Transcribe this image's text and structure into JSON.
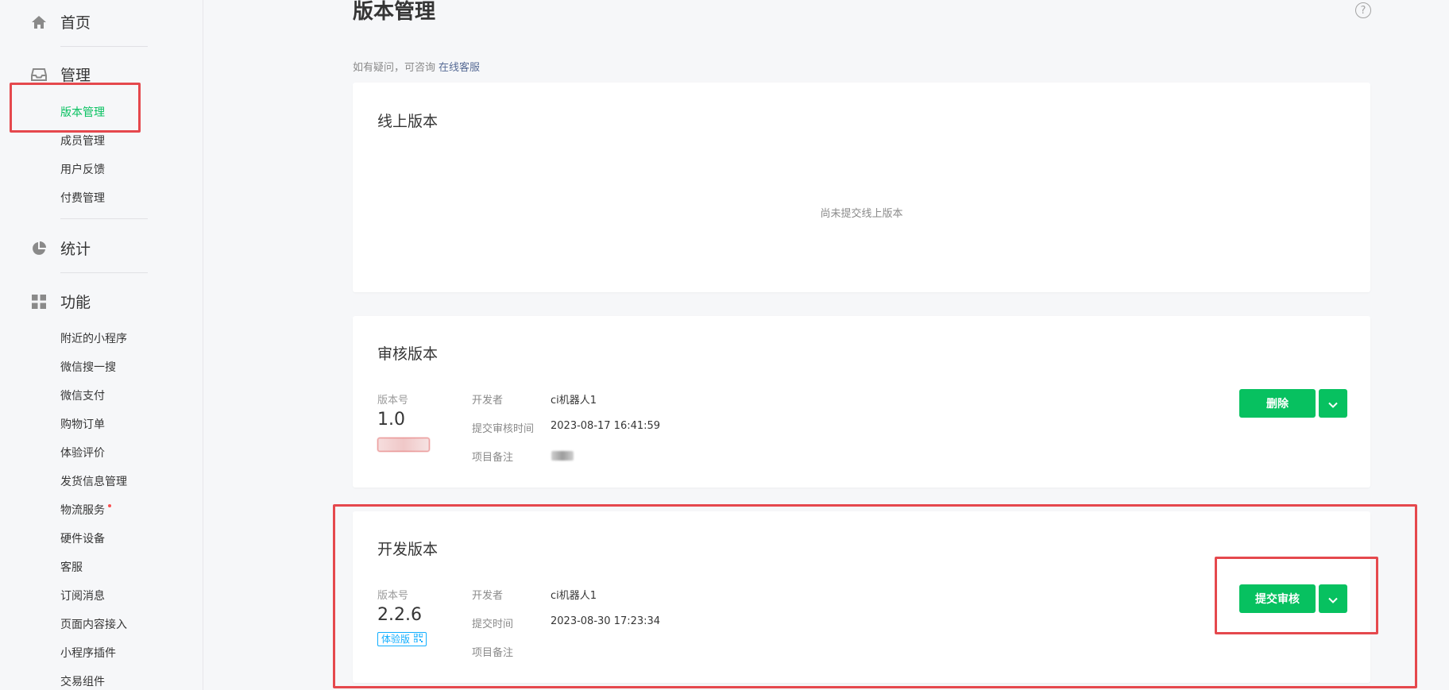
{
  "sidebar": {
    "home": {
      "label": "首页",
      "icon": "home-icon"
    },
    "manage": {
      "label": "管理",
      "icon": "inbox-icon",
      "items": [
        {
          "label": "版本管理",
          "active": true
        },
        {
          "label": "成员管理"
        },
        {
          "label": "用户反馈"
        },
        {
          "label": "付费管理"
        }
      ]
    },
    "stats": {
      "label": "统计",
      "icon": "pie-chart-icon"
    },
    "features": {
      "label": "功能",
      "icon": "grid-icon",
      "items": [
        {
          "label": "附近的小程序"
        },
        {
          "label": "微信搜一搜"
        },
        {
          "label": "微信支付"
        },
        {
          "label": "购物订单"
        },
        {
          "label": "体验评价"
        },
        {
          "label": "发货信息管理"
        },
        {
          "label": "物流服务",
          "dot": true
        },
        {
          "label": "硬件设备"
        },
        {
          "label": "客服"
        },
        {
          "label": "订阅消息"
        },
        {
          "label": "页面内容接入"
        },
        {
          "label": "小程序插件"
        },
        {
          "label": "交易组件"
        }
      ]
    }
  },
  "main": {
    "title": "版本管理",
    "help": "?",
    "hint": {
      "text": "如有疑问，可咨询",
      "link": "在线客服"
    },
    "online": {
      "title": "线上版本",
      "empty": "尚未提交线上版本"
    },
    "review": {
      "title": "审核版本",
      "version_label": "版本号",
      "version": "1.0",
      "fields": [
        {
          "key": "开发者",
          "value": "ci机器人1"
        },
        {
          "key": "提交审核时间",
          "value": "2023-08-17 16:41:59"
        },
        {
          "key": "项目备注",
          "value": ""
        }
      ],
      "button": "删除"
    },
    "dev": {
      "title": "开发版本",
      "version_label": "版本号",
      "version": "2.2.6",
      "tag": "体验版",
      "fields": [
        {
          "key": "开发者",
          "value": "ci机器人1"
        },
        {
          "key": "提交时间",
          "value": "2023-08-30 17:23:34"
        },
        {
          "key": "项目备注",
          "value": ""
        }
      ],
      "button": "提交审核"
    }
  },
  "colors": {
    "brand": "#07c160",
    "link": "#576b95",
    "highlight": "#e5484d",
    "tag": "#10aeff"
  }
}
